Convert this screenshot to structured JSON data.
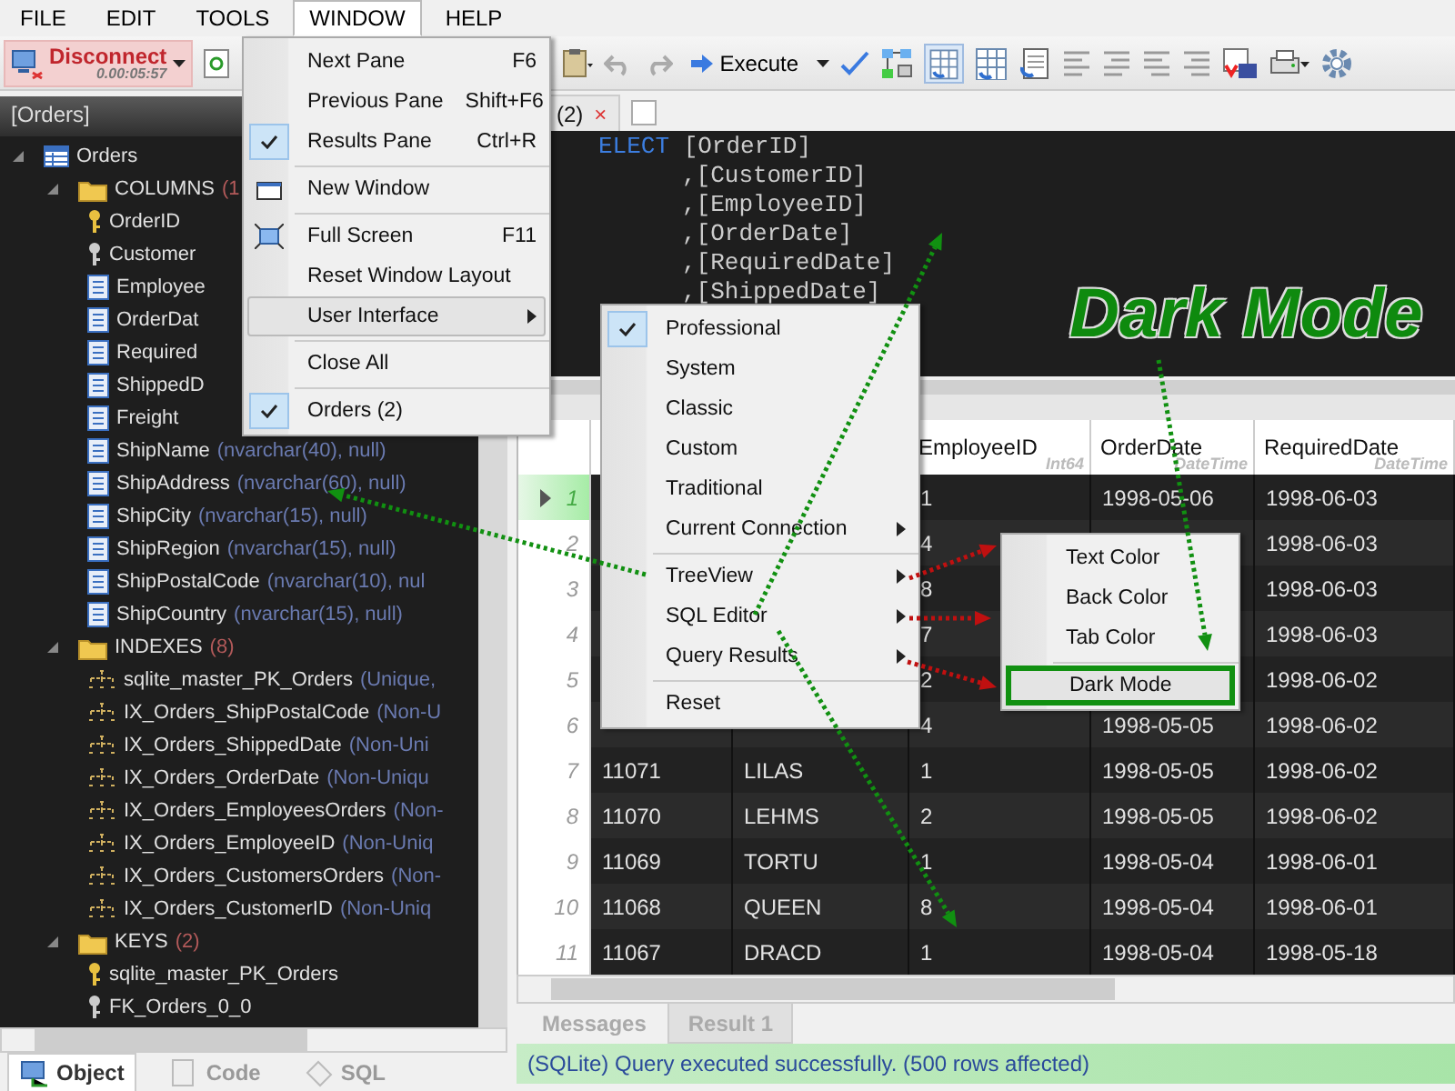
{
  "menubar": [
    {
      "label": "FILE",
      "selected": false
    },
    {
      "label": "EDIT",
      "selected": false
    },
    {
      "label": "TOOLS",
      "selected": false
    },
    {
      "label": "WINDOW",
      "selected": true
    },
    {
      "label": "HELP",
      "selected": false
    }
  ],
  "toolbar": {
    "disconnect": {
      "label": "Disconnect",
      "timer": "0.00:05:57"
    },
    "execute": {
      "label": "Execute"
    }
  },
  "object_panel": {
    "title": "[Orders]",
    "tree": [
      {
        "label": "Orders",
        "kind": "table",
        "expanded": true,
        "children": [
          {
            "label": "COLUMNS",
            "count": "(1",
            "kind": "folder",
            "expanded": true,
            "children": [
              {
                "label": "OrderID",
                "kind": "key"
              },
              {
                "label": "Customer",
                "kind": "fkey"
              },
              {
                "label": "Employee",
                "kind": "column"
              },
              {
                "label": "OrderDat",
                "kind": "column"
              },
              {
                "label": "Required",
                "kind": "column"
              },
              {
                "label": "ShippedD",
                "kind": "column"
              },
              {
                "label": "Freight",
                "kind": "column"
              },
              {
                "label": "ShipName",
                "detail": "(nvarchar(40), null)",
                "kind": "column"
              },
              {
                "label": "ShipAddress",
                "detail": "(nvarchar(60), null)",
                "kind": "column"
              },
              {
                "label": "ShipCity",
                "detail": "(nvarchar(15), null)",
                "kind": "column"
              },
              {
                "label": "ShipRegion",
                "detail": "(nvarchar(15), null)",
                "kind": "column"
              },
              {
                "label": "ShipPostalCode",
                "detail": "(nvarchar(10), nul",
                "kind": "column"
              },
              {
                "label": "ShipCountry",
                "detail": "(nvarchar(15), null)",
                "kind": "column"
              }
            ]
          },
          {
            "label": "INDEXES",
            "count": "(8)",
            "kind": "folder",
            "expanded": true,
            "children": [
              {
                "label": "sqlite_master_PK_Orders",
                "detail": "(Unique,",
                "kind": "index"
              },
              {
                "label": "IX_Orders_ShipPostalCode",
                "detail": "(Non-U",
                "kind": "index"
              },
              {
                "label": "IX_Orders_ShippedDate",
                "detail": "(Non-Uni",
                "kind": "index"
              },
              {
                "label": "IX_Orders_OrderDate",
                "detail": "(Non-Uniqu",
                "kind": "index"
              },
              {
                "label": "IX_Orders_EmployeesOrders",
                "detail": "(Non-",
                "kind": "index"
              },
              {
                "label": "IX_Orders_EmployeeID",
                "detail": "(Non-Uniq",
                "kind": "index"
              },
              {
                "label": "IX_Orders_CustomersOrders",
                "detail": "(Non-",
                "kind": "index"
              },
              {
                "label": "IX_Orders_CustomerID",
                "detail": "(Non-Uniq",
                "kind": "index"
              }
            ]
          },
          {
            "label": "KEYS",
            "count": "(2)",
            "kind": "folder",
            "expanded": true,
            "children": [
              {
                "label": "sqlite_master_PK_Orders",
                "kind": "key"
              },
              {
                "label": "FK_Orders_0_0",
                "kind": "fkey"
              }
            ]
          }
        ]
      }
    ]
  },
  "object_tabs": [
    {
      "label": "Object",
      "selected": true
    },
    {
      "label": "Code",
      "selected": false
    },
    {
      "label": "SQL",
      "selected": false
    }
  ],
  "editor": {
    "tab": {
      "label": "(2)",
      "close": "×"
    },
    "lines": [
      {
        "keyword": "ELECT",
        "text": "[OrderID]"
      },
      {
        "text": ",[CustomerID]"
      },
      {
        "text": ",[EmployeeID]"
      },
      {
        "text": ",[OrderDate]"
      },
      {
        "text": ",[RequiredDate]"
      },
      {
        "text": ",[ShippedDate]"
      }
    ]
  },
  "overlay_label": "Dark Mode",
  "grid": {
    "columns": [
      null,
      null,
      {
        "name": "EmployeeID",
        "type": "Int64"
      },
      {
        "name": "OrderDate",
        "type": "DateTime"
      },
      {
        "name": "RequiredDate",
        "type": "DateTime"
      }
    ],
    "rows": [
      {
        "number": "1",
        "selected": true,
        "cells": [
          null,
          null,
          "1",
          "1998-05-06",
          "1998-06-03"
        ]
      },
      {
        "number": "2",
        "selected": false,
        "cells": [
          null,
          null,
          "4",
          null,
          "1998-06-03"
        ]
      },
      {
        "number": "3",
        "selected": false,
        "cells": [
          null,
          null,
          "8",
          null,
          "1998-06-03"
        ]
      },
      {
        "number": "4",
        "selected": false,
        "cells": [
          null,
          null,
          "7",
          null,
          "1998-06-03"
        ]
      },
      {
        "number": "5",
        "selected": false,
        "cells": [
          null,
          null,
          "2",
          null,
          "1998-06-02"
        ]
      },
      {
        "number": "6",
        "selected": false,
        "cells": [
          null,
          null,
          "4",
          "1998-05-05",
          "1998-06-02"
        ]
      },
      {
        "number": "7",
        "selected": false,
        "cells": [
          "11071",
          "LILAS",
          "1",
          "1998-05-05",
          "1998-06-02"
        ]
      },
      {
        "number": "8",
        "selected": false,
        "cells": [
          "11070",
          "LEHMS",
          "2",
          "1998-05-05",
          "1998-06-02"
        ]
      },
      {
        "number": "9",
        "selected": false,
        "cells": [
          "11069",
          "TORTU",
          "1",
          "1998-05-04",
          "1998-06-01"
        ]
      },
      {
        "number": "10",
        "selected": false,
        "cells": [
          "11068",
          "QUEEN",
          "8",
          "1998-05-04",
          "1998-06-01"
        ]
      },
      {
        "number": "11",
        "selected": false,
        "cells": [
          "11067",
          "DRACD",
          "1",
          "1998-05-04",
          "1998-05-18"
        ]
      }
    ]
  },
  "result_tabs": [
    {
      "label": "Messages",
      "selected": false
    },
    {
      "label": "Result 1",
      "selected": true
    }
  ],
  "status_bar": "(SQLite) Query executed successfully. (500 rows affected)",
  "window_menu": {
    "items": [
      {
        "kind": "item",
        "label": "Next Pane",
        "shortcut": "F6",
        "checked": false
      },
      {
        "kind": "item",
        "label": "Previous Pane",
        "shortcut": "Shift+F6",
        "checked": false
      },
      {
        "kind": "item",
        "label": "Results Pane",
        "shortcut": "Ctrl+R",
        "checked": true
      },
      {
        "kind": "separator"
      },
      {
        "kind": "newwindow",
        "label": "New Window",
        "checked": false
      },
      {
        "kind": "separator"
      },
      {
        "kind": "fullscreen",
        "label": "Full Screen",
        "shortcut": "F11",
        "checked": false
      },
      {
        "kind": "item",
        "label": "Reset Window Layout",
        "checked": false
      },
      {
        "kind": "item",
        "label": "User Interface",
        "submenu": true,
        "selected": true,
        "checked": false
      },
      {
        "kind": "separator"
      },
      {
        "kind": "item",
        "label": "Close All",
        "checked": false
      },
      {
        "kind": "separator"
      },
      {
        "kind": "item",
        "label": "Orders (2)",
        "checked": true
      }
    ]
  },
  "interface_menu": {
    "items": [
      {
        "kind": "item",
        "label": "Professional",
        "checked": true
      },
      {
        "kind": "item",
        "label": "System",
        "checked": false
      },
      {
        "kind": "item",
        "label": "Classic",
        "checked": false
      },
      {
        "kind": "item",
        "label": "Custom",
        "checked": false
      },
      {
        "kind": "item",
        "label": "Traditional",
        "checked": false
      },
      {
        "kind": "item",
        "label": "Current Connection",
        "submenu": true,
        "checked": false
      },
      {
        "kind": "separator"
      },
      {
        "kind": "item",
        "label": "TreeView",
        "submenu": true,
        "checked": false
      },
      {
        "kind": "item",
        "label": "SQL Editor",
        "submenu": true,
        "checked": false
      },
      {
        "kind": "item",
        "label": "Query Results",
        "submenu": true,
        "checked": false
      },
      {
        "kind": "separator"
      },
      {
        "kind": "item",
        "label": "Reset",
        "checked": false
      }
    ]
  },
  "color_menu": {
    "items": [
      {
        "kind": "item",
        "label": "Text Color",
        "checked": false
      },
      {
        "kind": "item",
        "label": "Back Color",
        "checked": false
      },
      {
        "kind": "item",
        "label": "Tab Color",
        "checked": false
      },
      {
        "kind": "separator"
      },
      {
        "kind": "item",
        "label": "Dark Mode",
        "selected": true,
        "checked": false
      }
    ]
  }
}
